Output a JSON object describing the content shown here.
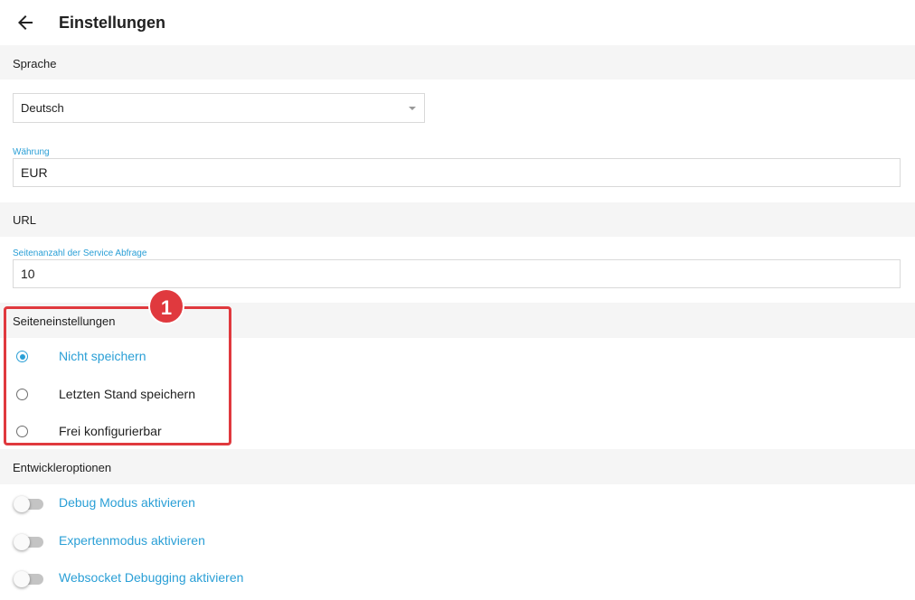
{
  "header": {
    "title": "Einstellungen",
    "back_icon": "arrow-left-icon"
  },
  "sections": {
    "sprache": "Sprache",
    "url": "URL",
    "seiteneinstellungen": "Seiteneinstellungen",
    "entwickleroptionen": "Entwickleroptionen"
  },
  "language_select": {
    "value": "Deutsch"
  },
  "currency": {
    "label": "Währung",
    "value": "EUR"
  },
  "page_count": {
    "label": "Seitenanzahl der Service Abfrage",
    "value": "10"
  },
  "page_settings": {
    "options": [
      {
        "label": "Nicht speichern",
        "selected": true
      },
      {
        "label": "Letzten Stand speichern",
        "selected": false
      },
      {
        "label": "Frei konfigurierbar",
        "selected": false
      }
    ]
  },
  "developer": {
    "toggles": [
      {
        "label": "Debug Modus aktivieren",
        "on": false
      },
      {
        "label": "Expertenmodus aktivieren",
        "on": false
      },
      {
        "label": "Websocket Debugging aktivieren",
        "on": false
      }
    ]
  },
  "annotation": {
    "badge": "1"
  },
  "colors": {
    "accent": "#2a9fd6",
    "highlight": "#e0393e",
    "section_bg": "#f5f5f5"
  }
}
